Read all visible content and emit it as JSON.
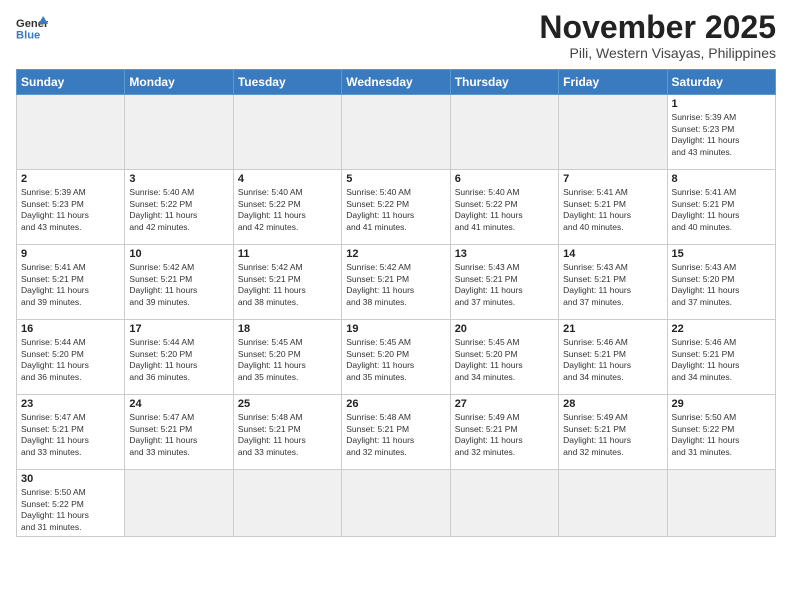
{
  "header": {
    "logo_general": "General",
    "logo_blue": "Blue",
    "month_title": "November 2025",
    "subtitle": "Pili, Western Visayas, Philippines"
  },
  "days_of_week": [
    "Sunday",
    "Monday",
    "Tuesday",
    "Wednesday",
    "Thursday",
    "Friday",
    "Saturday"
  ],
  "weeks": [
    [
      {
        "day": "",
        "info": "",
        "empty": true
      },
      {
        "day": "",
        "info": "",
        "empty": true
      },
      {
        "day": "",
        "info": "",
        "empty": true
      },
      {
        "day": "",
        "info": "",
        "empty": true
      },
      {
        "day": "",
        "info": "",
        "empty": true
      },
      {
        "day": "",
        "info": "",
        "empty": true
      },
      {
        "day": "1",
        "info": "Sunrise: 5:39 AM\nSunset: 5:23 PM\nDaylight: 11 hours\nand 43 minutes."
      }
    ],
    [
      {
        "day": "2",
        "info": "Sunrise: 5:39 AM\nSunset: 5:23 PM\nDaylight: 11 hours\nand 43 minutes."
      },
      {
        "day": "3",
        "info": "Sunrise: 5:40 AM\nSunset: 5:22 PM\nDaylight: 11 hours\nand 42 minutes."
      },
      {
        "day": "4",
        "info": "Sunrise: 5:40 AM\nSunset: 5:22 PM\nDaylight: 11 hours\nand 42 minutes."
      },
      {
        "day": "5",
        "info": "Sunrise: 5:40 AM\nSunset: 5:22 PM\nDaylight: 11 hours\nand 41 minutes."
      },
      {
        "day": "6",
        "info": "Sunrise: 5:40 AM\nSunset: 5:22 PM\nDaylight: 11 hours\nand 41 minutes."
      },
      {
        "day": "7",
        "info": "Sunrise: 5:41 AM\nSunset: 5:21 PM\nDaylight: 11 hours\nand 40 minutes."
      },
      {
        "day": "8",
        "info": "Sunrise: 5:41 AM\nSunset: 5:21 PM\nDaylight: 11 hours\nand 40 minutes."
      }
    ],
    [
      {
        "day": "9",
        "info": "Sunrise: 5:41 AM\nSunset: 5:21 PM\nDaylight: 11 hours\nand 39 minutes."
      },
      {
        "day": "10",
        "info": "Sunrise: 5:42 AM\nSunset: 5:21 PM\nDaylight: 11 hours\nand 39 minutes."
      },
      {
        "day": "11",
        "info": "Sunrise: 5:42 AM\nSunset: 5:21 PM\nDaylight: 11 hours\nand 38 minutes."
      },
      {
        "day": "12",
        "info": "Sunrise: 5:42 AM\nSunset: 5:21 PM\nDaylight: 11 hours\nand 38 minutes."
      },
      {
        "day": "13",
        "info": "Sunrise: 5:43 AM\nSunset: 5:21 PM\nDaylight: 11 hours\nand 37 minutes."
      },
      {
        "day": "14",
        "info": "Sunrise: 5:43 AM\nSunset: 5:21 PM\nDaylight: 11 hours\nand 37 minutes."
      },
      {
        "day": "15",
        "info": "Sunrise: 5:43 AM\nSunset: 5:20 PM\nDaylight: 11 hours\nand 37 minutes."
      }
    ],
    [
      {
        "day": "16",
        "info": "Sunrise: 5:44 AM\nSunset: 5:20 PM\nDaylight: 11 hours\nand 36 minutes."
      },
      {
        "day": "17",
        "info": "Sunrise: 5:44 AM\nSunset: 5:20 PM\nDaylight: 11 hours\nand 36 minutes."
      },
      {
        "day": "18",
        "info": "Sunrise: 5:45 AM\nSunset: 5:20 PM\nDaylight: 11 hours\nand 35 minutes."
      },
      {
        "day": "19",
        "info": "Sunrise: 5:45 AM\nSunset: 5:20 PM\nDaylight: 11 hours\nand 35 minutes."
      },
      {
        "day": "20",
        "info": "Sunrise: 5:45 AM\nSunset: 5:20 PM\nDaylight: 11 hours\nand 34 minutes."
      },
      {
        "day": "21",
        "info": "Sunrise: 5:46 AM\nSunset: 5:21 PM\nDaylight: 11 hours\nand 34 minutes."
      },
      {
        "day": "22",
        "info": "Sunrise: 5:46 AM\nSunset: 5:21 PM\nDaylight: 11 hours\nand 34 minutes."
      }
    ],
    [
      {
        "day": "23",
        "info": "Sunrise: 5:47 AM\nSunset: 5:21 PM\nDaylight: 11 hours\nand 33 minutes."
      },
      {
        "day": "24",
        "info": "Sunrise: 5:47 AM\nSunset: 5:21 PM\nDaylight: 11 hours\nand 33 minutes."
      },
      {
        "day": "25",
        "info": "Sunrise: 5:48 AM\nSunset: 5:21 PM\nDaylight: 11 hours\nand 33 minutes."
      },
      {
        "day": "26",
        "info": "Sunrise: 5:48 AM\nSunset: 5:21 PM\nDaylight: 11 hours\nand 32 minutes."
      },
      {
        "day": "27",
        "info": "Sunrise: 5:49 AM\nSunset: 5:21 PM\nDaylight: 11 hours\nand 32 minutes."
      },
      {
        "day": "28",
        "info": "Sunrise: 5:49 AM\nSunset: 5:21 PM\nDaylight: 11 hours\nand 32 minutes."
      },
      {
        "day": "29",
        "info": "Sunrise: 5:50 AM\nSunset: 5:22 PM\nDaylight: 11 hours\nand 31 minutes."
      }
    ],
    [
      {
        "day": "30",
        "info": "Sunrise: 5:50 AM\nSunset: 5:22 PM\nDaylight: 11 hours\nand 31 minutes."
      },
      {
        "day": "",
        "info": "",
        "empty": true
      },
      {
        "day": "",
        "info": "",
        "empty": true
      },
      {
        "day": "",
        "info": "",
        "empty": true
      },
      {
        "day": "",
        "info": "",
        "empty": true
      },
      {
        "day": "",
        "info": "",
        "empty": true
      },
      {
        "day": "",
        "info": "",
        "empty": true
      }
    ]
  ]
}
